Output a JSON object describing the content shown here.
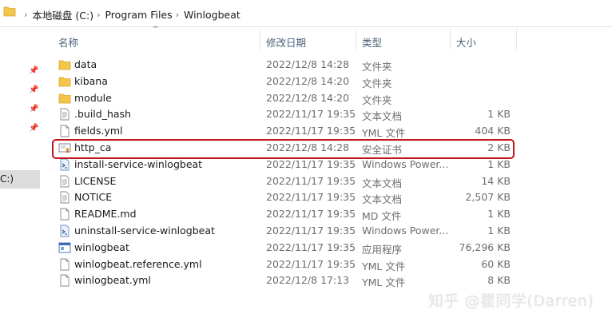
{
  "breadcrumb": {
    "items": [
      "本地磁盘 (C:)",
      "Program Files",
      "Winlogbeat"
    ]
  },
  "nav": {
    "selected_label": "C:)"
  },
  "columns": {
    "name": "名称",
    "modified": "修改日期",
    "type": "类型",
    "size": "大小"
  },
  "files": [
    {
      "name": "data",
      "modified": "2022/12/8 14:28",
      "type": "文件夹",
      "size": "",
      "icon": "folder-icon"
    },
    {
      "name": "kibana",
      "modified": "2022/12/8 14:20",
      "type": "文件夹",
      "size": "",
      "icon": "folder-icon"
    },
    {
      "name": "module",
      "modified": "2022/12/8 14:20",
      "type": "文件夹",
      "size": "",
      "icon": "folder-icon"
    },
    {
      "name": ".build_hash",
      "modified": "2022/11/17 19:35",
      "type": "文本文档",
      "size": "1 KB",
      "icon": "text-file-icon"
    },
    {
      "name": "fields.yml",
      "modified": "2022/11/17 19:35",
      "type": "YML 文件",
      "size": "404 KB",
      "icon": "file-icon"
    },
    {
      "name": "http_ca",
      "modified": "2022/12/8 14:28",
      "type": "安全证书",
      "size": "2 KB",
      "icon": "certificate-icon"
    },
    {
      "name": "install-service-winlogbeat",
      "modified": "2022/11/17 19:35",
      "type": "Windows Power...",
      "size": "1 KB",
      "icon": "powershell-icon"
    },
    {
      "name": "LICENSE",
      "modified": "2022/11/17 19:35",
      "type": "文本文档",
      "size": "14 KB",
      "icon": "text-file-icon"
    },
    {
      "name": "NOTICE",
      "modified": "2022/11/17 19:35",
      "type": "文本文档",
      "size": "2,507 KB",
      "icon": "text-file-icon"
    },
    {
      "name": "README.md",
      "modified": "2022/11/17 19:35",
      "type": "MD 文件",
      "size": "1 KB",
      "icon": "file-icon"
    },
    {
      "name": "uninstall-service-winlogbeat",
      "modified": "2022/11/17 19:35",
      "type": "Windows Power...",
      "size": "1 KB",
      "icon": "powershell-icon"
    },
    {
      "name": "winlogbeat",
      "modified": "2022/11/17 19:35",
      "type": "应用程序",
      "size": "76,296 KB",
      "icon": "application-icon"
    },
    {
      "name": "winlogbeat.reference.yml",
      "modified": "2022/11/17 19:35",
      "type": "YML 文件",
      "size": "60 KB",
      "icon": "file-icon"
    },
    {
      "name": "winlogbeat.yml",
      "modified": "2022/12/8 17:13",
      "type": "YML 文件",
      "size": "8 KB",
      "icon": "file-icon"
    }
  ],
  "highlight_color": "#c0141c",
  "watermark": "知乎 @瞿同学(Darren)"
}
